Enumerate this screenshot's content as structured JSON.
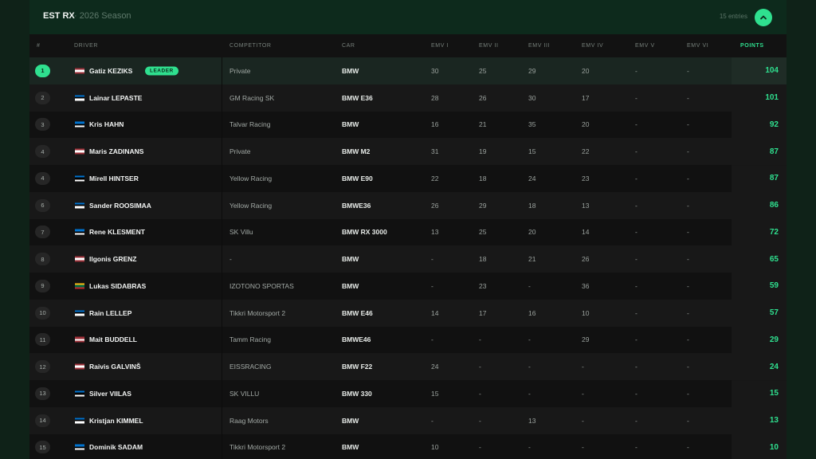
{
  "header": {
    "title": "EST RX",
    "season": "· 2026 Season",
    "entries": "15 entries",
    "collapse_icon": "chevron-up-icon"
  },
  "colors": {
    "accent": "#2fe08f",
    "flag_lv": [
      "#9e3039",
      "#ffffff",
      "#9e3039"
    ],
    "flag_ee": [
      "#0072ce",
      "#000000",
      "#ffffff"
    ],
    "flag_lt": [
      "#fdb913",
      "#006a44",
      "#c1272d"
    ]
  },
  "columns": {
    "pos": "#",
    "driver": "DRIVER",
    "competitor": "COMPETITOR",
    "car": "CAR",
    "emv1": "EMV I",
    "emv2": "EMV II",
    "emv3": "EMV III",
    "emv4": "EMV IV",
    "emv5": "EMV V",
    "emv6": "EMV VI",
    "points": "POINTS"
  },
  "leader_badge": "LEADER",
  "rows": [
    {
      "pos": "1",
      "flag": "lv",
      "driver": "Gatiz KEZIKS",
      "competitor": "Private",
      "car": "BMW",
      "emv": [
        "30",
        "25",
        "29",
        "20",
        "-",
        "-"
      ],
      "points": "104"
    },
    {
      "pos": "2",
      "flag": "ee",
      "driver": "Lainar LEPASTE",
      "competitor": "GM Racing SK",
      "car": "BMW E36",
      "emv": [
        "28",
        "26",
        "30",
        "17",
        "-",
        "-"
      ],
      "points": "101"
    },
    {
      "pos": "3",
      "flag": "ee",
      "driver": "Kris HAHN",
      "competitor": "Talvar Racing",
      "car": "BMW",
      "emv": [
        "16",
        "21",
        "35",
        "20",
        "-",
        "-"
      ],
      "points": "92"
    },
    {
      "pos": "4",
      "flag": "lv",
      "driver": "Maris ZADINANS",
      "competitor": "Private",
      "car": "BMW M2",
      "emv": [
        "31",
        "19",
        "15",
        "22",
        "-",
        "-"
      ],
      "points": "87"
    },
    {
      "pos": "4",
      "flag": "ee",
      "driver": "Mirell HINTSER",
      "competitor": "Yellow Racing",
      "car": "BMW E90",
      "emv": [
        "22",
        "18",
        "24",
        "23",
        "-",
        "-"
      ],
      "points": "87"
    },
    {
      "pos": "6",
      "flag": "ee",
      "driver": "Sander ROOSIMAA",
      "competitor": "Yellow Racing",
      "car": "BMWE36",
      "emv": [
        "26",
        "29",
        "18",
        "13",
        "-",
        "-"
      ],
      "points": "86"
    },
    {
      "pos": "7",
      "flag": "ee",
      "driver": "Rene KLESMENT",
      "competitor": "SK Villu",
      "car": "BMW RX 3000",
      "emv": [
        "13",
        "25",
        "20",
        "14",
        "-",
        "-"
      ],
      "points": "72"
    },
    {
      "pos": "8",
      "flag": "lv",
      "driver": "Ilgonis GRENZ",
      "competitor": "-",
      "car": "BMW",
      "emv": [
        "-",
        "18",
        "21",
        "26",
        "-",
        "-"
      ],
      "points": "65"
    },
    {
      "pos": "9",
      "flag": "lt",
      "driver": "Lukas SIDABRAS",
      "competitor": "IZOTONO SPORTAS",
      "car": "BMW",
      "emv": [
        "-",
        "23",
        "-",
        "36",
        "-",
        "-"
      ],
      "points": "59"
    },
    {
      "pos": "10",
      "flag": "ee",
      "driver": "Rain LELLEP",
      "competitor": "Tikkri Motorsport 2",
      "car": "BMW E46",
      "emv": [
        "14",
        "17",
        "16",
        "10",
        "-",
        "-"
      ],
      "points": "57"
    },
    {
      "pos": "11",
      "flag": "lv",
      "driver": "Mait BUDDELL",
      "competitor": "Tamm Racing",
      "car": "BMWE46",
      "emv": [
        "-",
        "-",
        "-",
        "29",
        "-",
        "-"
      ],
      "points": "29"
    },
    {
      "pos": "12",
      "flag": "lv",
      "driver": "Raivis GALVINŠ",
      "competitor": "EISSRACING",
      "car": "BMW F22",
      "emv": [
        "24",
        "-",
        "-",
        "-",
        "-",
        "-"
      ],
      "points": "24"
    },
    {
      "pos": "13",
      "flag": "ee",
      "driver": "Silver VIILAS",
      "competitor": "SK VILLU",
      "car": "BMW 330",
      "emv": [
        "15",
        "-",
        "-",
        "-",
        "-",
        "-"
      ],
      "points": "15"
    },
    {
      "pos": "14",
      "flag": "ee",
      "driver": "Kristjan KIMMEL",
      "competitor": "Raag Motors",
      "car": "BMW",
      "emv": [
        "-",
        "-",
        "13",
        "-",
        "-",
        "-"
      ],
      "points": "13"
    },
    {
      "pos": "15",
      "flag": "ee",
      "driver": "Dominik SADAM",
      "competitor": "Tikkri Motorsport 2",
      "car": "BMW",
      "emv": [
        "10",
        "-",
        "-",
        "-",
        "-",
        "-"
      ],
      "points": "10"
    }
  ]
}
